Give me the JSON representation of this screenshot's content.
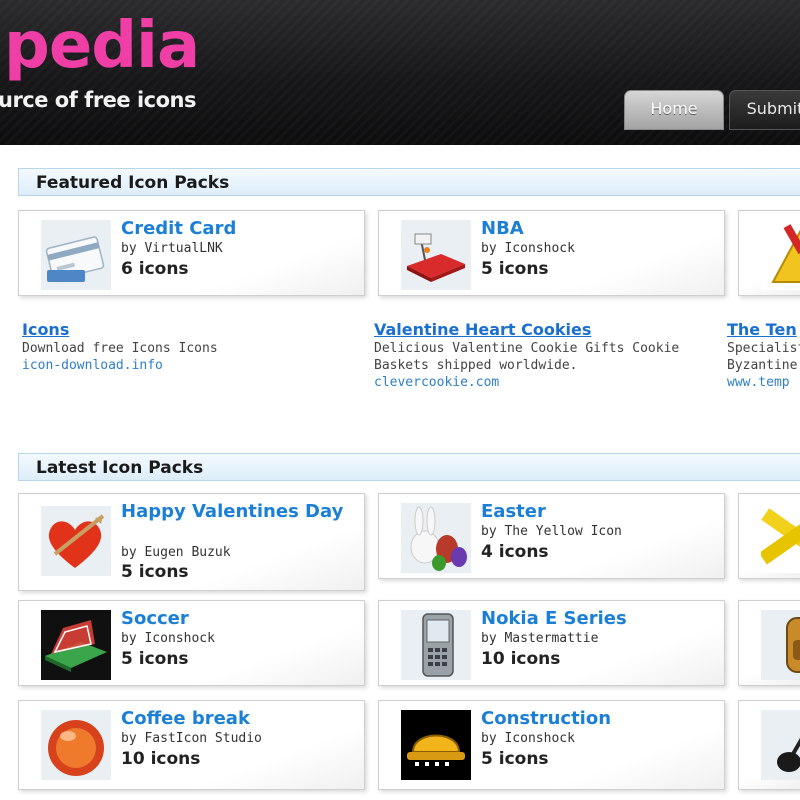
{
  "header": {
    "logo_text": "pedia",
    "tagline": "urce of free icons",
    "tabs": [
      {
        "label": "Home"
      },
      {
        "label": "Submit"
      }
    ]
  },
  "featured": {
    "heading": "Featured Icon Packs",
    "cards": [
      {
        "title": "Credit Card",
        "author": "by VirtualLNK",
        "count": "6 icons",
        "icon": "credit-card-icon"
      },
      {
        "title": "NBA",
        "author": "by Iconshock",
        "count": "5 icons",
        "icon": "basketball-court-icon"
      },
      {
        "icon": "warning-sign-icon"
      }
    ]
  },
  "ads": [
    {
      "title": "Icons",
      "desc": "Download free Icons Icons",
      "url": "icon-download.info"
    },
    {
      "title": "Valentine Heart Cookies",
      "desc": "Delicious Valentine Cookie Gifts Cookie Baskets shipped worldwide.",
      "url": "clevercookie.com"
    },
    {
      "title": "The Ten",
      "desc": "Specialist Byzantine",
      "url": "www.temp"
    }
  ],
  "latest": {
    "heading": "Latest Icon Packs",
    "cards": [
      {
        "title": "Happy Valentines Day",
        "author": "by Eugen Buzuk",
        "count": "5 icons",
        "icon": "heart-icon"
      },
      {
        "title": "Easter",
        "author": "by The Yellow Icon",
        "count": "4 icons",
        "icon": "easter-bunny-icon"
      },
      {
        "icon": "caution-tape-icon"
      },
      {
        "title": "Soccer",
        "author": "by Iconshock",
        "count": "5 icons",
        "icon": "soccer-field-icon"
      },
      {
        "title": "Nokia E Series",
        "author": "by Mastermattie",
        "count": "10 icons",
        "icon": "mobile-phone-icon"
      },
      {
        "icon": "backpack-icon"
      },
      {
        "title": "Coffee break",
        "author": "by FastIcon Studio",
        "count": "10 icons",
        "icon": "coffee-icon"
      },
      {
        "title": "Construction",
        "author": "by Iconshock",
        "count": "5 icons",
        "icon": "hard-hat-icon"
      },
      {
        "icon": "guitar-icon"
      }
    ]
  },
  "colors": {
    "brand_pink": "#ef3fa6",
    "link_blue": "#1b7fd6",
    "section_bar": "#dcedf9"
  }
}
